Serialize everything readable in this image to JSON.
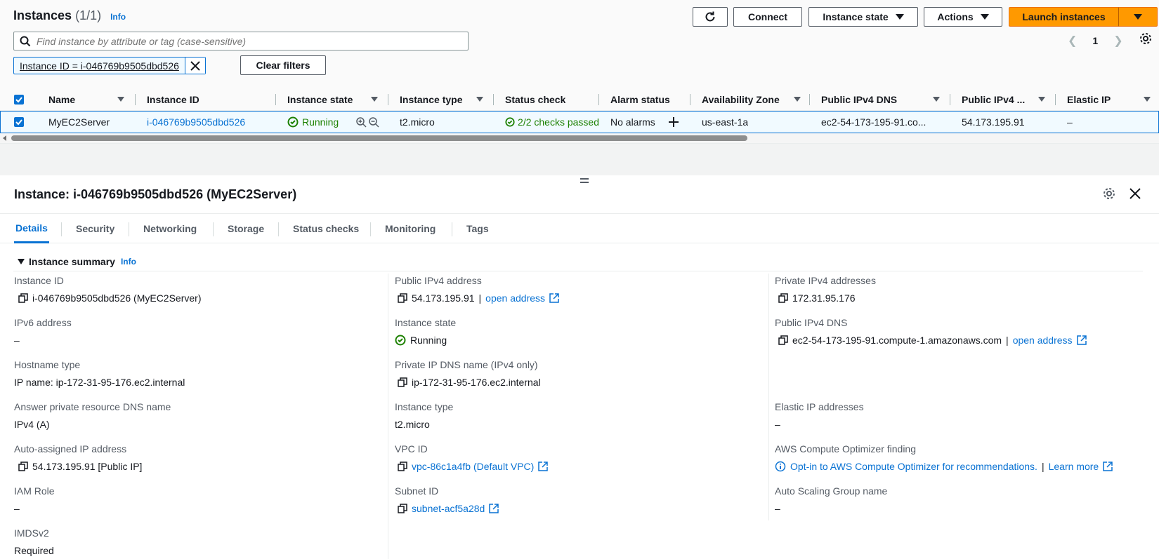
{
  "header": {
    "title": "Instances",
    "count": "(1/1)",
    "info": "Info",
    "connect": "Connect",
    "instance_state": "Instance state",
    "actions": "Actions",
    "launch": "Launch instances"
  },
  "search": {
    "placeholder": "Find instance by attribute or tag (case-sensitive)"
  },
  "pagination": {
    "page": "1"
  },
  "filter": {
    "token": "Instance ID = i-046769b9505dbd526",
    "clear": "Clear filters"
  },
  "table": {
    "columns": [
      "Name",
      "Instance ID",
      "Instance state",
      "Instance type",
      "Status check",
      "Alarm status",
      "Availability Zone",
      "Public IPv4 DNS",
      "Public IPv4 ...",
      "Elastic IP"
    ],
    "row": {
      "name": "MyEC2Server",
      "instance_id": "i-046769b9505dbd526",
      "state": "Running",
      "type": "t2.micro",
      "status_check": "2/2 checks passed",
      "alarm": "No alarms",
      "az": "us-east-1a",
      "dns": "ec2-54-173-195-91.co...",
      "ipv4": "54.173.195.91",
      "eip": "–"
    }
  },
  "detail": {
    "title": "Instance: i-046769b9505dbd526 (MyEC2Server)",
    "tabs": [
      "Details",
      "Security",
      "Networking",
      "Storage",
      "Status checks",
      "Monitoring",
      "Tags"
    ],
    "summary": "Instance summary",
    "info": "Info",
    "open_address": "open address",
    "learn_more": "Learn more",
    "fields": {
      "instance_id_k": "Instance ID",
      "instance_id_v": "i-046769b9505dbd526 (MyEC2Server)",
      "ipv6_k": "IPv6 address",
      "ipv6_v": "–",
      "hostname_k": "Hostname type",
      "hostname_v": "IP name: ip-172-31-95-176.ec2.internal",
      "answer_k": "Answer private resource DNS name",
      "answer_v": "IPv4 (A)",
      "auto_ip_k": "Auto-assigned IP address",
      "auto_ip_v": "54.173.195.91 [Public IP]",
      "iam_k": "IAM Role",
      "iam_v": "–",
      "imds_k": "IMDSv2",
      "imds_v": "Required",
      "pub_ip_k": "Public IPv4 address",
      "pub_ip_v": "54.173.195.91",
      "state_k": "Instance state",
      "state_v": "Running",
      "priv_dns_k": "Private IP DNS name (IPv4 only)",
      "priv_dns_v": "ip-172-31-95-176.ec2.internal",
      "type_k": "Instance type",
      "type_v": "t2.micro",
      "vpc_k": "VPC ID",
      "vpc_v": "vpc-86c1a4fb (Default VPC)",
      "subnet_k": "Subnet ID",
      "subnet_v": "subnet-acf5a28d",
      "priv_ip_k": "Private IPv4 addresses",
      "priv_ip_v": "172.31.95.176",
      "pub_dns_k": "Public IPv4 DNS",
      "pub_dns_v": "ec2-54-173-195-91.compute-1.amazonaws.com",
      "eip_k": "Elastic IP addresses",
      "eip_v": "–",
      "optimizer_k": "AWS Compute Optimizer finding",
      "optimizer_v": "Opt-in to AWS Compute Optimizer for recommendations.",
      "asg_k": "Auto Scaling Group name",
      "asg_v": "–"
    }
  },
  "colors": {
    "accent": "#0972d3",
    "launch": "#ff9900",
    "success": "#1d8102"
  }
}
